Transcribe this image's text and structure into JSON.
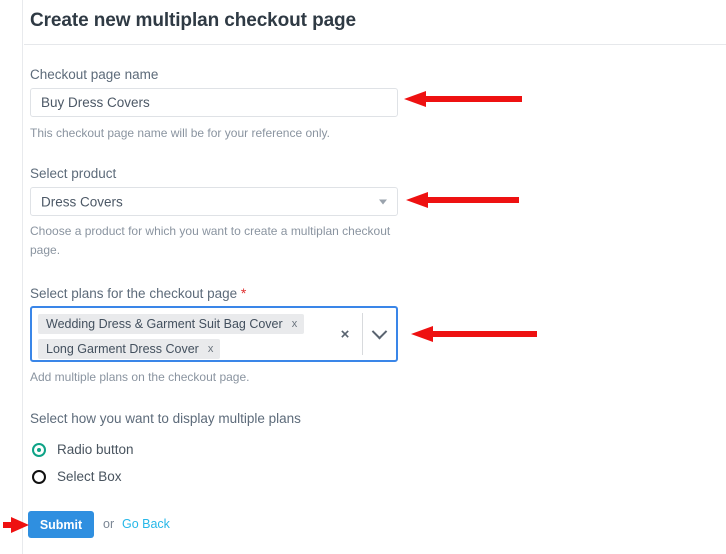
{
  "header": {
    "title": "Create new multiplan checkout page"
  },
  "form": {
    "name_field": {
      "label": "Checkout page name",
      "value": "Buy Dress Covers",
      "placeholder": "Checkout page name",
      "help": "This checkout page name will be for your reference only."
    },
    "product_field": {
      "label": "Select product",
      "value": "Dress Covers",
      "help": "Choose a product for which you want to create a multiplan checkout page.",
      "caret_icon": "chevron-down-icon"
    },
    "plans_field": {
      "label": "Select plans for the checkout page",
      "required_marker": "*",
      "help": "Add multiple plans on the checkout page.",
      "chips": [
        {
          "label": "Wedding Dress & Garment Suit Bag Cover",
          "remove_icon": "x"
        },
        {
          "label": "Long Garment Dress Cover",
          "remove_icon": "x"
        }
      ],
      "clear_icon": "×",
      "clear_icon_name": "clear-all-icon",
      "caret_icon_name": "chevron-down-icon"
    },
    "display_mode": {
      "label": "Select how you want to display multiple plans",
      "options": [
        {
          "label": "Radio button",
          "selected": true
        },
        {
          "label": "Select Box",
          "selected": false
        }
      ]
    }
  },
  "footer": {
    "submit_label": "Submit",
    "or_label": "or",
    "go_back_label": "Go Back"
  },
  "colors": {
    "accent_blue": "#2f8fe0",
    "focus_blue": "#3a86e8",
    "link_cyan": "#26b7e8",
    "radio_teal": "#0ea387",
    "annotation_red": "#ee1111",
    "required_red": "#e03030"
  },
  "annotations": [
    {
      "name": "arrow-to-name-field",
      "direction": "left"
    },
    {
      "name": "arrow-to-product-field",
      "direction": "left"
    },
    {
      "name": "arrow-to-plans-field",
      "direction": "left"
    },
    {
      "name": "arrow-to-submit-button",
      "direction": "right"
    }
  ]
}
